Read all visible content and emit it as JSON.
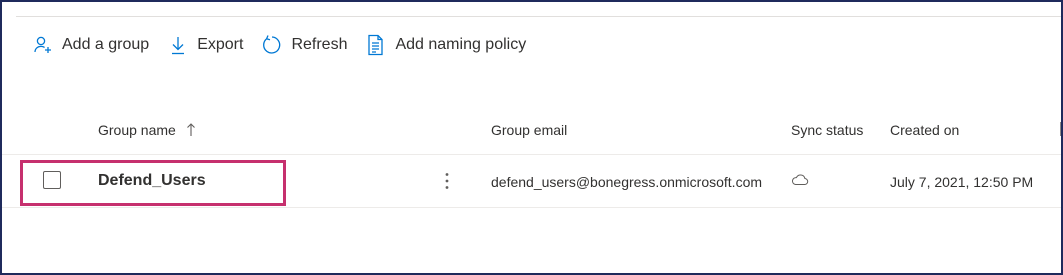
{
  "toolbar": {
    "add_group": "Add a group",
    "export": "Export",
    "refresh": "Refresh",
    "add_naming_policy": "Add naming policy"
  },
  "table": {
    "columns": {
      "group_name": "Group name",
      "group_email": "Group email",
      "sync_status": "Sync status",
      "created_on": "Created on"
    },
    "sort": {
      "column": "group_name",
      "direction": "ascending"
    },
    "rows": [
      {
        "group_name": "Defend_Users",
        "group_email": "defend_users@bonegress.onmicrosoft.com",
        "sync_status_icon": "cloud-icon",
        "created_on": "July 7, 2021, 12:50 PM",
        "selected": false,
        "highlighted": true
      }
    ]
  },
  "colors": {
    "highlight_border": "#c6306e",
    "accent_icon": "#0078d4",
    "frame_border": "#1f2a5c"
  }
}
